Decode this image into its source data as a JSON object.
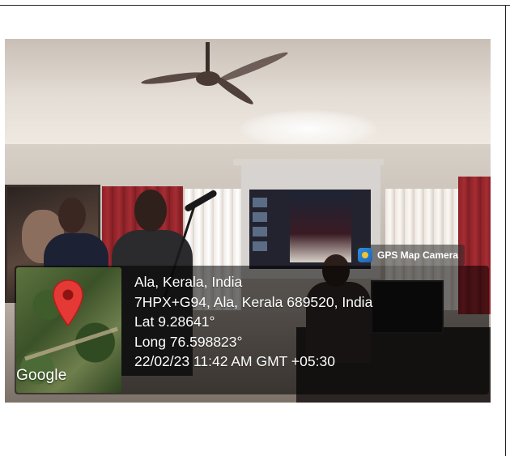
{
  "overlay": {
    "badge_label": "GPS Map Camera",
    "map_watermark": "Google",
    "location_title": "Ala, Kerala, India",
    "address": "7HPX+G94, Ala, Kerala 689520, India",
    "latitude": "Lat 9.28641°",
    "longitude": "Long 76.598823°",
    "datetime": "22/02/23 11:42 AM GMT +05:30"
  },
  "icons": {
    "badge_icon": "gps-map-camera-app-icon",
    "map_pin": "location-pin-icon"
  },
  "colors": {
    "pin_red": "#e53935",
    "overlay_text": "#ffffff",
    "overlay_background": "rgba(0,0,0,0.55)"
  }
}
